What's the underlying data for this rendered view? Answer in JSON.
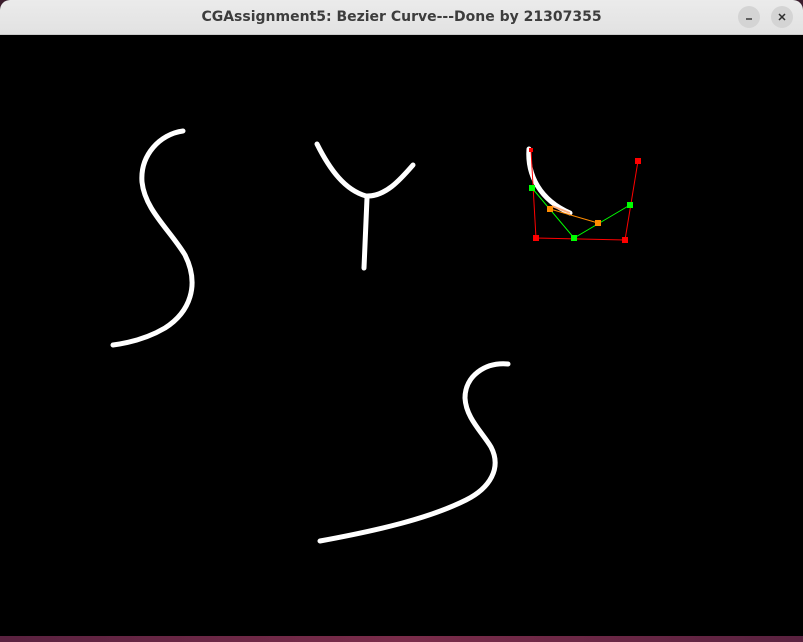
{
  "window": {
    "title": "CGAssignment5: Bezier Curve---Done by 21307355"
  },
  "titlebar_buttons": [
    {
      "name": "minimize",
      "icon": "minimize-icon"
    },
    {
      "name": "close",
      "icon": "close-icon"
    }
  ],
  "colors": {
    "canvas_background": "#000000",
    "stroke": "#ffffff",
    "control_polygon": "#ff0000",
    "level1": "#00ff00",
    "level2": "#ff8c00",
    "titlebar": "#e8e8e8"
  }
}
